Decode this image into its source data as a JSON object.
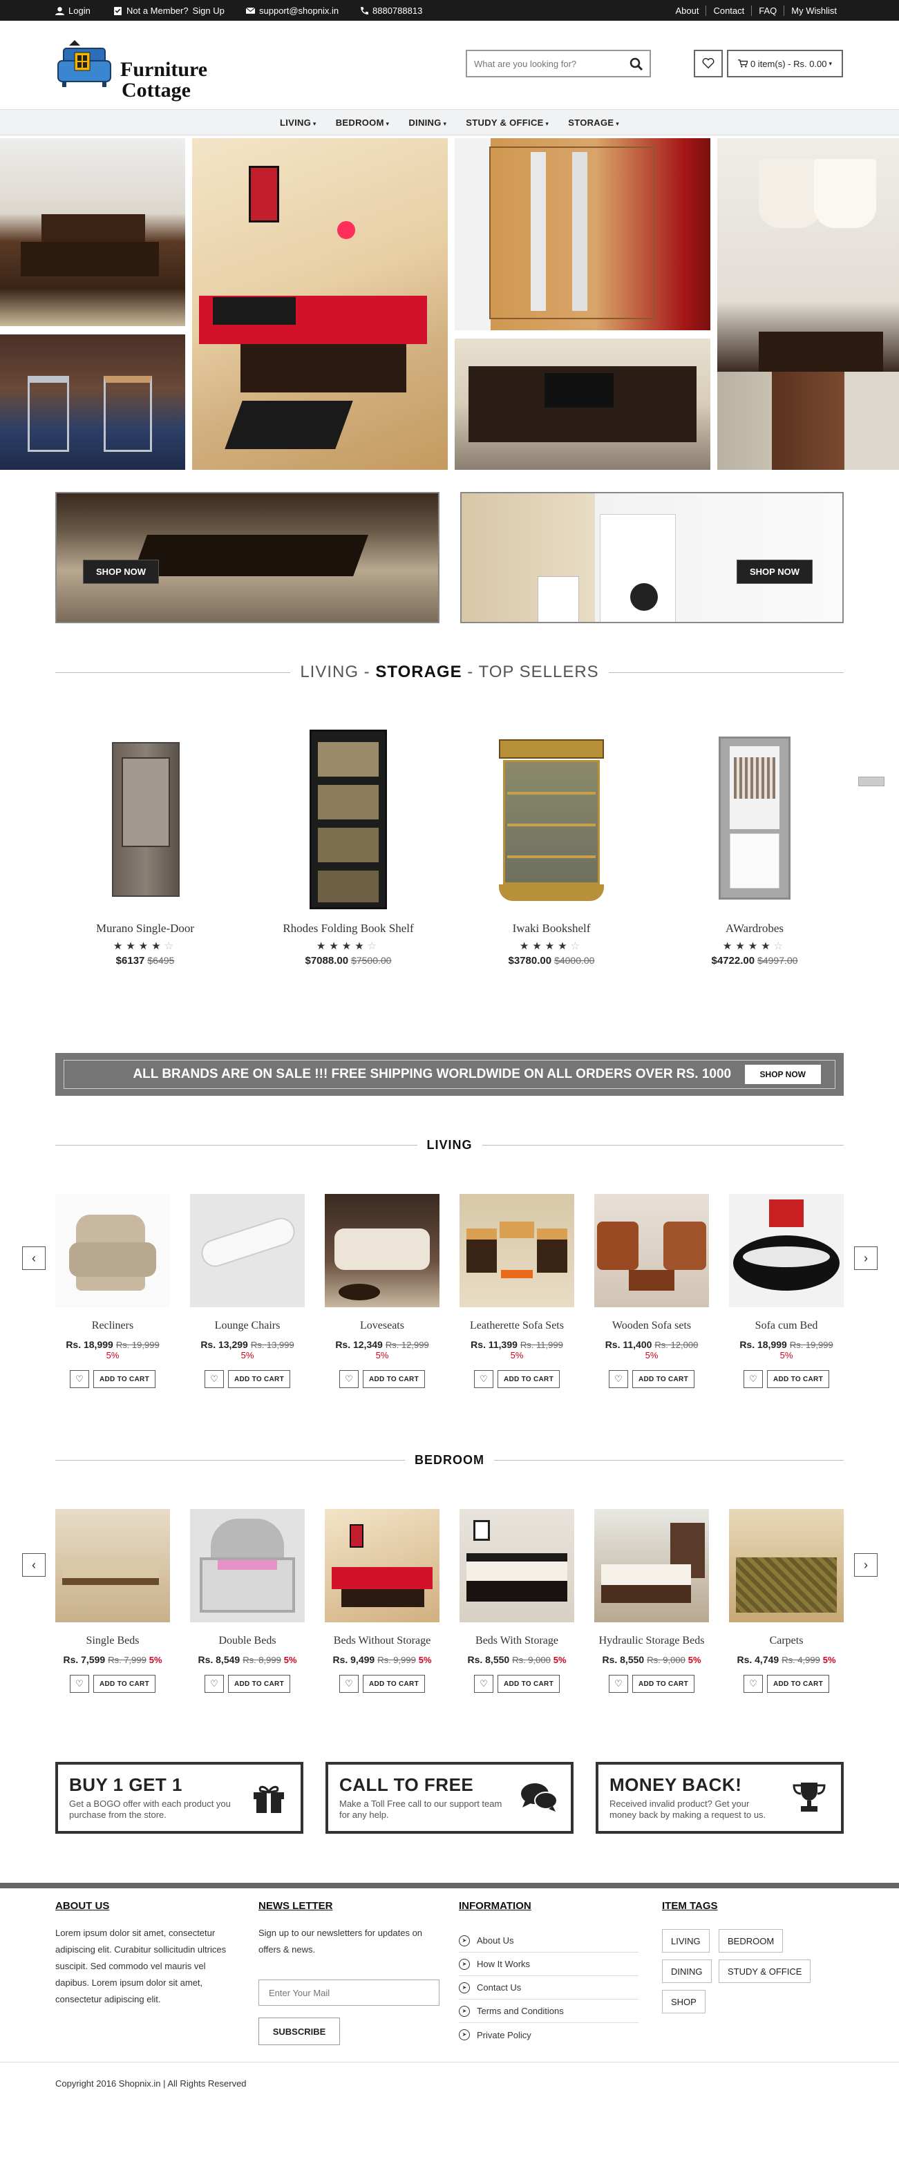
{
  "topbar": {
    "login": "Login",
    "member": "Not a Member?",
    "signup": "Sign Up",
    "email": "support@shopnix.in",
    "phone": "8880788813",
    "links": [
      "About",
      "Contact",
      "FAQ",
      "My Wishlist"
    ]
  },
  "header": {
    "logo_line1": "Furniture",
    "logo_line2": "Cottage",
    "search_placeholder": "What are you looking for?",
    "cart_label": "0 item(s) - Rs. 0.00"
  },
  "nav": [
    "LIVING",
    "BEDROOM",
    "DINING",
    "STUDY & OFFICE",
    "STORAGE"
  ],
  "promos": {
    "left_button": "SHOP NOW",
    "right_button": "SHOP NOW"
  },
  "top_sellers": {
    "title_pre": "LIVING -",
    "title_bold": "STORAGE",
    "title_post": "- TOP SELLERS",
    "items": [
      {
        "name": "Murano Single-Door",
        "price": "$6137",
        "old": "$6495",
        "rating": 4
      },
      {
        "name": "Rhodes Folding Book Shelf",
        "price": "$7088.00",
        "old": "$7500.00",
        "rating": 4
      },
      {
        "name": "Iwaki Bookshelf",
        "price": "$3780.00",
        "old": "$4000.00",
        "rating": 4
      },
      {
        "name": "AWardrobes",
        "price": "$4722.00",
        "old": "$4997.00",
        "rating": 4
      }
    ]
  },
  "banner": {
    "text": "ALL BRANDS ARE ON SALE !!! FREE SHIPPING WORLDWIDE ON ALL ORDERS OVER RS. 1000",
    "button": "SHOP NOW"
  },
  "living": {
    "title": "LIVING",
    "items": [
      {
        "name": "Recliners",
        "price": "Rs. 18,999",
        "old": "Rs. 19,999",
        "disc": "5%"
      },
      {
        "name": "Lounge Chairs",
        "price": "Rs. 13,299",
        "old": "Rs. 13,999",
        "disc": "5%"
      },
      {
        "name": "Loveseats",
        "price": "Rs. 12,349",
        "old": "Rs. 12,999",
        "disc": "5%"
      },
      {
        "name": "Leatherette Sofa Sets",
        "price": "Rs. 11,399",
        "old": "Rs. 11,999",
        "disc": "5%"
      },
      {
        "name": "Wooden Sofa sets",
        "price": "Rs. 11,400",
        "old": "Rs. 12,000",
        "disc": "5%"
      },
      {
        "name": "Sofa cum Bed",
        "price": "Rs. 18,999",
        "old": "Rs. 19,999",
        "disc": "5%"
      }
    ]
  },
  "bedroom": {
    "title": "BEDROOM",
    "items": [
      {
        "name": "Single Beds",
        "price": "Rs. 7,599",
        "old": "Rs. 7,999",
        "disc": "5%"
      },
      {
        "name": "Double Beds",
        "price": "Rs. 8,549",
        "old": "Rs. 8,999",
        "disc": "5%"
      },
      {
        "name": "Beds Without Storage",
        "price": "Rs. 9,499",
        "old": "Rs. 9,999",
        "disc": "5%"
      },
      {
        "name": "Beds With Storage",
        "price": "Rs. 8,550",
        "old": "Rs. 9,000",
        "disc": "5%"
      },
      {
        "name": "Hydraulic Storage Beds",
        "price": "Rs. 8,550",
        "old": "Rs. 9,000",
        "disc": "5%"
      },
      {
        "name": "Carpets",
        "price": "Rs. 4,749",
        "old": "Rs. 4,999",
        "disc": "5%"
      }
    ]
  },
  "add_to_cart": "ADD TO CART",
  "features": [
    {
      "title": "BUY 1 GET 1",
      "text": "Get a BOGO offer with each product you purchase from the store.",
      "icon": "gift-icon"
    },
    {
      "title": "CALL TO FREE",
      "text": "Make a Toll Free call to our support team for any help.",
      "icon": "chat-icon"
    },
    {
      "title": "MONEY BACK!",
      "text": "Received invalid product? Get your money back by making a request to us.",
      "icon": "trophy-icon"
    }
  ],
  "footer": {
    "about_title": "ABOUT US",
    "about_text": "Lorem ipsum dolor sit amet, consectetur adipiscing elit. Curabitur sollicitudin ultrices suscipit. Sed commodo vel mauris vel dapibus. Lorem ipsum dolor sit amet, consectetur adipiscing elit.",
    "news_title": "NEWS LETTER",
    "news_text": "Sign up to our newsletters for updates on offers & news.",
    "news_placeholder": "Enter Your Mail",
    "subscribe": "SUBSCRIBE",
    "info_title": "INFORMATION",
    "info_links": [
      "About Us",
      "How It Works",
      "Contact Us",
      "Terms and Conditions",
      "Private Policy"
    ],
    "tags_title": "ITEM TAGS",
    "tags": [
      "LIVING",
      "BEDROOM",
      "DINING",
      "STUDY & OFFICE",
      "SHOP"
    ],
    "copyright": "Copyright 2016 Shopnix.in | All Rights Reserved"
  }
}
